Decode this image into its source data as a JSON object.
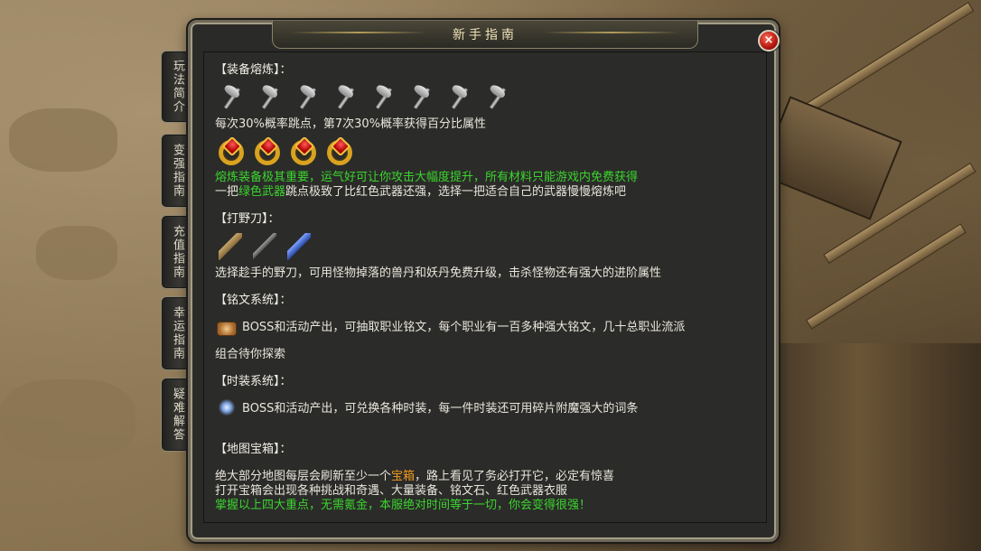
{
  "window": {
    "title": "新手指南",
    "close_label": "×"
  },
  "tabs": [
    {
      "label": "玩法简介"
    },
    {
      "label": "变强指南"
    },
    {
      "label": "充值指南"
    },
    {
      "label": "幸运指南"
    },
    {
      "label": "疑难解答"
    }
  ],
  "sections": {
    "equip": {
      "heading": "【装备熔炼】：",
      "line1": "每次30%概率跳点，第7次30%概率获得百分比属性",
      "line2": "熔炼装备极其重要，运气好可让你攻击大幅度提升，所有材料只能游戏内免费获得",
      "line3_a": "一把",
      "line3_green": "绿色武器",
      "line3_b": "跳点极致了比红色武器还强，选择一把适合自己的武器慢慢熔炼吧",
      "axe_count": 8,
      "ring_count": 4
    },
    "knife": {
      "heading": "【打野刀】：",
      "line1": "选择趁手的野刀，可用怪物掉落的兽丹和妖丹免费升级，击杀怪物还有强大的进阶属性"
    },
    "rune": {
      "heading": "【铭文系统】：",
      "line1": "BOSS和活动产出，可抽取职业铭文，每个职业有一百多种强大铭文，几十总职业流派",
      "line2": "组合待你探索"
    },
    "fashion": {
      "heading": "【时装系统】：",
      "line1": "BOSS和活动产出，可兑换各种时装，每一件时装还可用碎片附魔强大的词条"
    },
    "chest": {
      "heading": "【地图宝箱】：",
      "line1_a": "绝大部分地图每层会刷新至少一个",
      "line1_orange": "宝箱",
      "line1_b": "，路上看见了务必打开它，必定有惊喜",
      "line2": "打开宝箱会出现各种挑战和奇遇、大量装备、铭文石、红色武器衣服",
      "line3": "掌握以上四大重点，无需氪金，本服绝对时间等于一切，你会变得很强！"
    }
  },
  "colors": {
    "green": "#3bd62e",
    "orange": "#f29a1d",
    "text": "#e9e6dc"
  }
}
